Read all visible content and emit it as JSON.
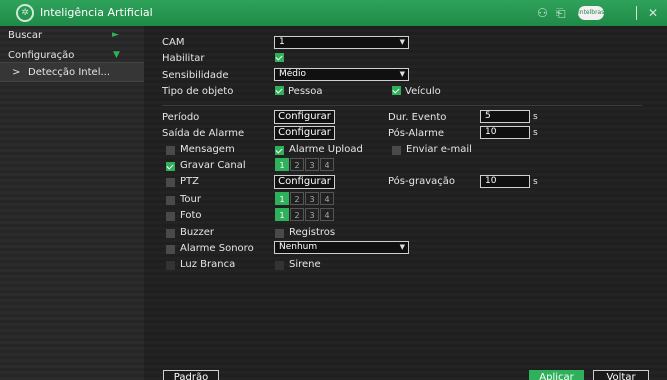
{
  "window": {
    "title": "Inteligência Artificial"
  },
  "titlebar_icons": [
    "user-icon",
    "logout-icon",
    "cloud-icon",
    "close-icon"
  ],
  "cloud_badge": "Intelbras Cloud",
  "close_glyph": "✕",
  "sidebar": {
    "items": [
      {
        "label": "Buscar",
        "arrow": "►"
      },
      {
        "label": "Configuração",
        "arrow": "▼"
      },
      {
        "label": "Detecção Intel...",
        "prefix": ">"
      }
    ]
  },
  "form": {
    "cam": {
      "label": "CAM",
      "value": "1"
    },
    "habilitar": {
      "label": "Habilitar",
      "checked": true
    },
    "sensibilidade": {
      "label": "Sensibilidade",
      "value": "Médio"
    },
    "tipo": {
      "label": "Tipo de objeto",
      "pessoa": "Pessoa",
      "veiculo": "Veículo"
    },
    "periodo": {
      "label": "Período",
      "button": "Configurar"
    },
    "dur_evento": {
      "label": "Dur. Evento",
      "value": "5",
      "unit": "s"
    },
    "saida_alarme": {
      "label": "Saída de Alarme",
      "button": "Configurar"
    },
    "pos_alarme": {
      "label": "Pós-Alarme",
      "value": "10",
      "unit": "s"
    },
    "mensagem": "Mensagem",
    "alarme_upload": "Alarme Upload",
    "enviar_email": "Enviar e-mail",
    "gravar_canal": "Gravar Canal",
    "ptz": {
      "label": "PTZ",
      "button": "Configurar"
    },
    "pos_gravacao": {
      "label": "Pós-gravação",
      "value": "10",
      "unit": "s"
    },
    "tour": "Tour",
    "foto": "Foto",
    "buzzer": "Buzzer",
    "registros": "Registros",
    "alarme_sonoro": {
      "label": "Alarme Sonoro",
      "value": "Nenhum"
    },
    "luz_branca": "Luz Branca",
    "sirene": "Sirene",
    "channels": [
      "1",
      "2",
      "3",
      "4"
    ]
  },
  "buttons": {
    "padrao": "Padrão",
    "aplicar": "Aplicar",
    "voltar": "Voltar"
  },
  "colors": {
    "accent": "#2fb15c",
    "titlebar": "#1f8a48"
  }
}
